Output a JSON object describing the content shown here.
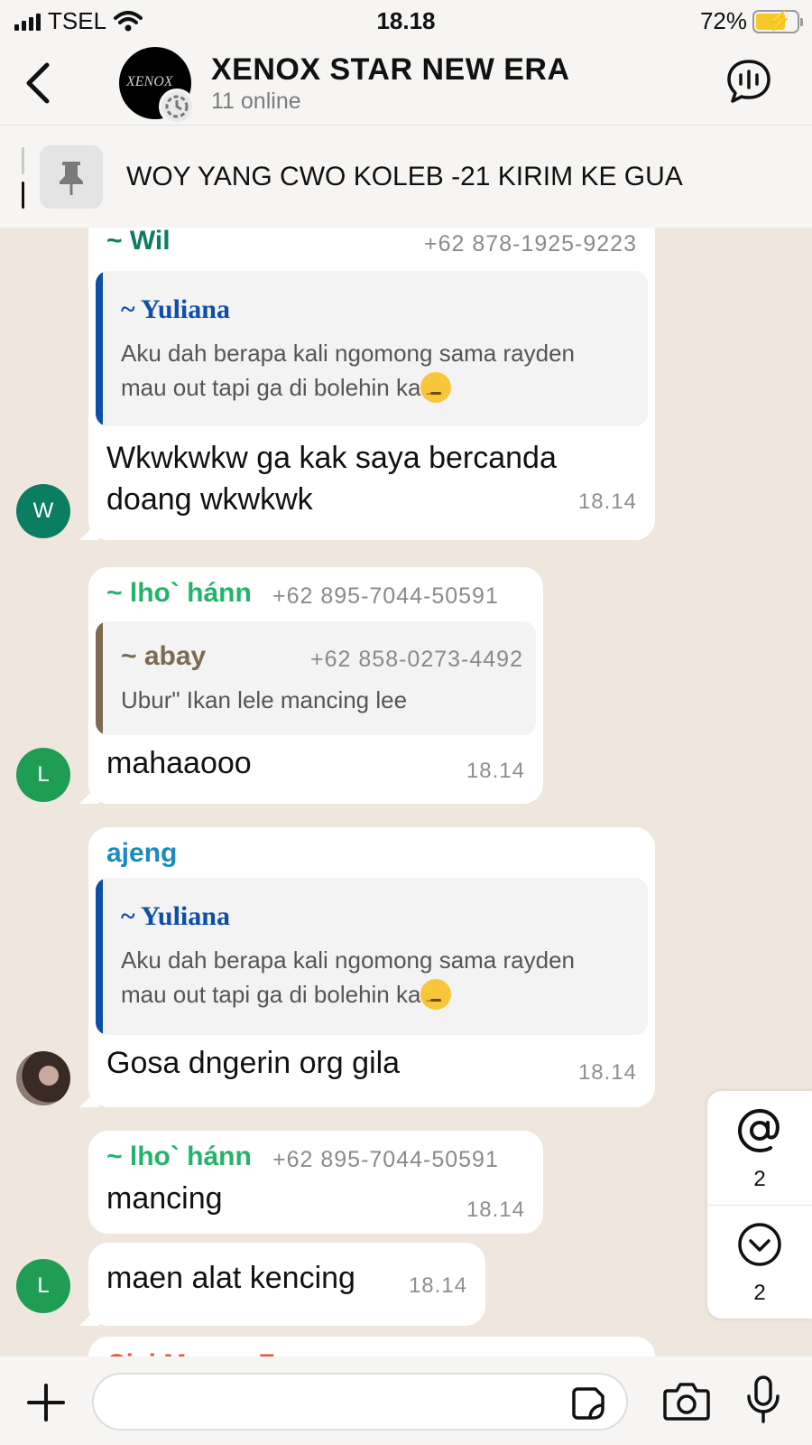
{
  "status_bar": {
    "carrier": "TSEL",
    "time": "18.18",
    "battery": "72%",
    "battery_level": 0.72
  },
  "header": {
    "title": "XENOX STAR NEW ERA",
    "subtitle": "11 online",
    "avatar_logo": "XENOX"
  },
  "pinned": {
    "text": "WOY YANG CWO KOLEB -21 KIRIM KE GUA"
  },
  "messages": [
    {
      "sender": "~ Wil",
      "phone": "+62 878-1925-9223",
      "sender_color": "#0b7d62",
      "quote": {
        "name": "~ Yuliana",
        "line1": "Aku dah berapa kali ngomong sama rayden",
        "line2": "mau out tapi ga di bolehin ka",
        "bar_color": "#0e4fa6"
      },
      "line1": "Wkwkwkw ga kak saya bercanda",
      "line2": "doang wkwkwk",
      "time": "18.14",
      "avatar": "W",
      "avatar_color": "#0b7d62"
    },
    {
      "sender": "~ lho` hánn",
      "phone": "+62 895-7044-50591",
      "sender_color": "#24b36b",
      "quote": {
        "name": "~ abay",
        "phone": "+62 858-0273-4492",
        "text": "Ubur\" Ikan lele mancing lee",
        "bar_color": "#7d6a50"
      },
      "text": "mahaaooo",
      "time": "18.14",
      "avatar": "L",
      "avatar_color": "#1f9d55"
    },
    {
      "sender": "ajeng",
      "sender_color": "#1a8bbf",
      "quote": {
        "name": "~ Yuliana",
        "line1": "Aku dah berapa kali ngomong sama rayden",
        "line2": "mau out tapi ga di bolehin ka",
        "bar_color": "#0e4fa6"
      },
      "text": "Gosa dngerin org gila",
      "time": "18.14"
    },
    {
      "sender": "~ lho` hánn",
      "phone": "+62 895-7044-50591",
      "sender_color": "#24b36b",
      "text": "mancing",
      "time": "18.14"
    },
    {
      "text": "maen alat kencing",
      "time": "18.14",
      "avatar": "L",
      "avatar_color": "#1f9d55"
    },
    {
      "sender": "Cici Meong Zunor",
      "sender_color": "#e05a3a"
    }
  ],
  "side_float": {
    "mentions": "2",
    "unread": "2"
  },
  "icons": {
    "back": "chevron-left-icon",
    "voice": "voice-chat-icon",
    "pin": "pin-icon",
    "mention": "at-icon",
    "scroll": "chevron-down-circle-icon",
    "add": "plus-icon",
    "sticker": "sticker-icon",
    "camera": "camera-icon",
    "mic": "microphone-icon"
  }
}
